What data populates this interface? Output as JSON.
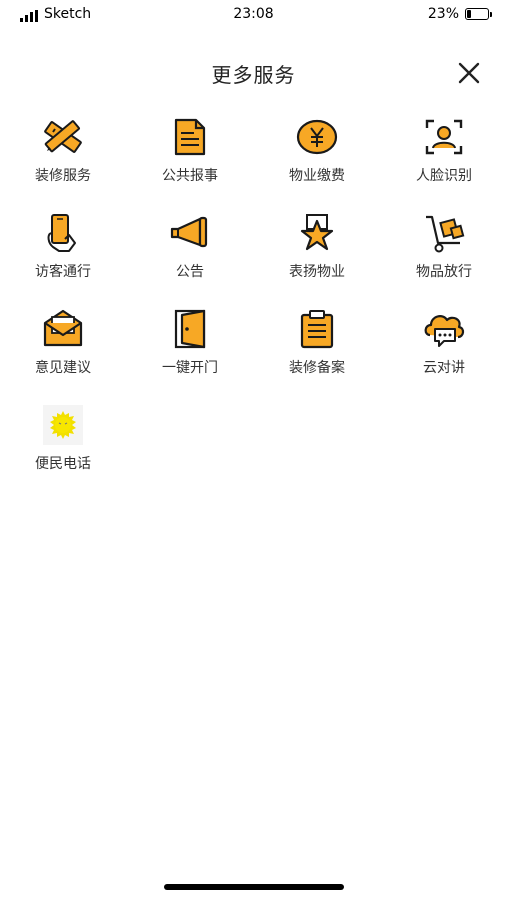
{
  "status_bar": {
    "carrier": "Sketch",
    "time": "23:08",
    "battery_text": "23%",
    "battery_level": 0.23
  },
  "header": {
    "title": "更多服务"
  },
  "colors": {
    "accent": "#F7A825",
    "outline": "#1a1a1a"
  },
  "services": [
    {
      "label": "装修服务",
      "icon": "ruler-pencil-icon"
    },
    {
      "label": "公共报事",
      "icon": "document-icon"
    },
    {
      "label": "物业缴费",
      "icon": "yen-coin-icon"
    },
    {
      "label": "人脸识别",
      "icon": "face-scan-icon"
    },
    {
      "label": "访客通行",
      "icon": "phone-hand-icon"
    },
    {
      "label": "公告",
      "icon": "megaphone-icon"
    },
    {
      "label": "表扬物业",
      "icon": "star-badge-icon"
    },
    {
      "label": "物品放行",
      "icon": "hand-truck-icon"
    },
    {
      "label": "意见建议",
      "icon": "envelope-icon"
    },
    {
      "label": "一键开门",
      "icon": "door-icon"
    },
    {
      "label": "装修备案",
      "icon": "clipboard-icon"
    },
    {
      "label": "云对讲",
      "icon": "cloud-chat-icon"
    },
    {
      "label": "便民电话",
      "icon": "sun-face-icon"
    }
  ]
}
